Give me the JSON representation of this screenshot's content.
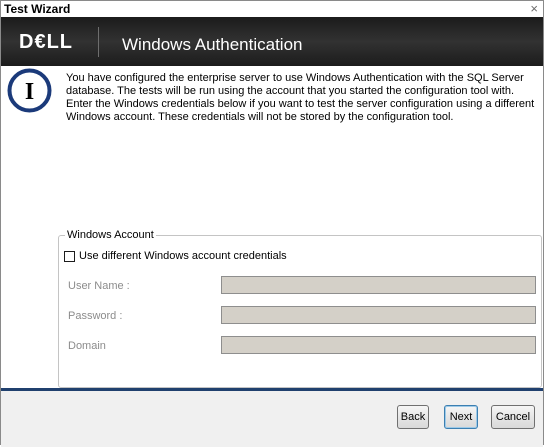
{
  "window": {
    "title": "Test Wizard",
    "close_glyph": "×"
  },
  "banner": {
    "logo": "D€LL",
    "heading": "Windows Authentication"
  },
  "info_icon": {
    "name": "info-icon",
    "glyph": "I",
    "ring_color": "#1b3a7a"
  },
  "message": "You have configured the enterprise server to use Windows Authentication with the SQL Server database. The tests will be run using the account that you started the configuration tool with. Enter the Windows credentials below if you want to test the server configuration using a different Windows account. These credentials will not be stored by the configuration tool.",
  "account_group": {
    "legend": "Windows Account",
    "checkbox_label": "Use different Windows account credentials",
    "checkbox_checked": false,
    "fields": [
      {
        "label": "User Name :",
        "value": ""
      },
      {
        "label": "Password :",
        "value": ""
      },
      {
        "label": "Domain",
        "value": ""
      }
    ]
  },
  "buttons": {
    "back": "Back",
    "next": "Next",
    "cancel": "Cancel"
  },
  "colors": {
    "banner_bg": "#262626",
    "footer_accent": "#20406e",
    "disabled_field_bg": "#d4d0c8",
    "disabled_label": "#8c8c8c"
  }
}
